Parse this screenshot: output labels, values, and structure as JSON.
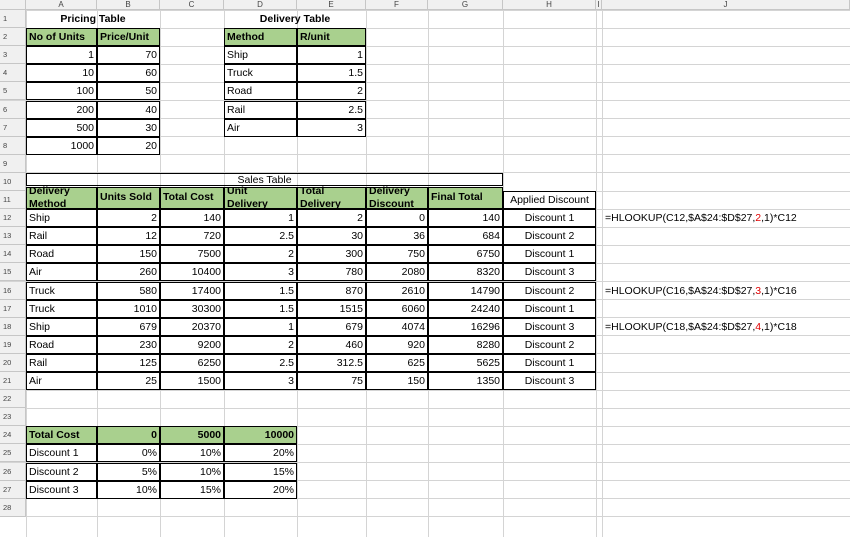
{
  "columns": [
    "A",
    "B",
    "C",
    "D",
    "E",
    "F",
    "G",
    "H",
    "I",
    "J"
  ],
  "rows": [
    "1",
    "2",
    "3",
    "4",
    "5",
    "6",
    "7",
    "8",
    "9",
    "10",
    "11",
    "12",
    "13",
    "14",
    "15",
    "16",
    "17",
    "18",
    "19",
    "20",
    "21",
    "22",
    "23",
    "24",
    "25",
    "26",
    "27",
    "28"
  ],
  "pricing": {
    "title": "Pricing Table",
    "headers": [
      "No of Units",
      "Price/Unit"
    ],
    "rows": [
      [
        "1",
        "70"
      ],
      [
        "10",
        "60"
      ],
      [
        "100",
        "50"
      ],
      [
        "200",
        "40"
      ],
      [
        "500",
        "30"
      ],
      [
        "1000",
        "20"
      ]
    ]
  },
  "delivery": {
    "title": "Delivery Table",
    "headers": [
      "Method",
      "R/unit"
    ],
    "rows": [
      [
        "Ship",
        "1"
      ],
      [
        "Truck",
        "1.5"
      ],
      [
        "Road",
        "2"
      ],
      [
        "Rail",
        "2.5"
      ],
      [
        "Air",
        "3"
      ]
    ]
  },
  "sales": {
    "title": "Sales Table",
    "headers": [
      [
        "Delivery",
        "Method"
      ],
      [
        "",
        "Units Sold"
      ],
      [
        "",
        "Total Cost"
      ],
      [
        "Unit",
        "Delivery"
      ],
      [
        "Total",
        "Delivery"
      ],
      [
        "Delivery",
        "Discount"
      ],
      [
        "",
        "Final Total"
      ]
    ],
    "applied_header": "Applied Discount",
    "rows": [
      [
        "Ship",
        "2",
        "140",
        "1",
        "2",
        "0",
        "140",
        "Discount 1"
      ],
      [
        "Rail",
        "12",
        "720",
        "2.5",
        "30",
        "36",
        "684",
        "Discount 2"
      ],
      [
        "Road",
        "150",
        "7500",
        "2",
        "300",
        "750",
        "6750",
        "Discount 1"
      ],
      [
        "Air",
        "260",
        "10400",
        "3",
        "780",
        "2080",
        "8320",
        "Discount 3"
      ],
      [
        "Truck",
        "580",
        "17400",
        "1.5",
        "870",
        "2610",
        "14790",
        "Discount 2"
      ],
      [
        "Truck",
        "1010",
        "30300",
        "1.5",
        "1515",
        "6060",
        "24240",
        "Discount 1"
      ],
      [
        "Ship",
        "679",
        "20370",
        "1",
        "679",
        "4074",
        "16296",
        "Discount 3"
      ],
      [
        "Road",
        "230",
        "9200",
        "2",
        "460",
        "920",
        "8280",
        "Discount 2"
      ],
      [
        "Rail",
        "125",
        "6250",
        "2.5",
        "312.5",
        "625",
        "5625",
        "Discount 1"
      ],
      [
        "Air",
        "25",
        "1500",
        "3",
        "75",
        "150",
        "1350",
        "Discount 3"
      ]
    ]
  },
  "formulas": [
    {
      "pre": "=HLOOKUP(C12,$A$24:$D$27,",
      "num": "2",
      "post": ",1)*C12"
    },
    {
      "pre": "=HLOOKUP(C16,$A$24:$D$27,",
      "num": "3",
      "post": ",1)*C16"
    },
    {
      "pre": "=HLOOKUP(C18,$A$24:$D$27,",
      "num": "4",
      "post": ",1)*C18"
    }
  ],
  "discount": {
    "headers": [
      "Total Cost",
      "0",
      "5000",
      "10000"
    ],
    "rows": [
      [
        "Discount 1",
        "0%",
        "10%",
        "20%"
      ],
      [
        "Discount 2",
        "5%",
        "10%",
        "15%"
      ],
      [
        "Discount 3",
        "10%",
        "15%",
        "20%"
      ]
    ]
  },
  "colors": {
    "header_green": "#a9d08e",
    "formula_highlight": "#e00000"
  }
}
